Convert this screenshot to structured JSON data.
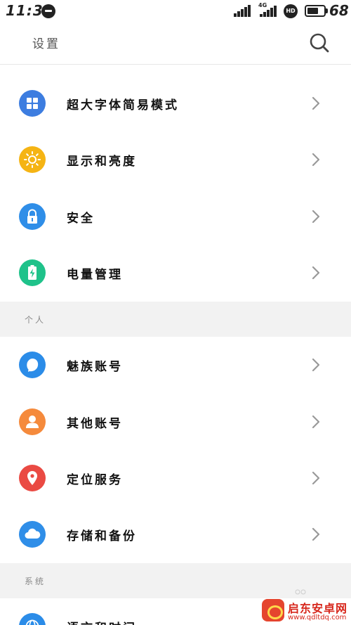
{
  "status_bar": {
    "time": "11:33",
    "network_type": "4G",
    "hd_label": "HD",
    "battery_percent": "68",
    "battery_level": 0.68
  },
  "header": {
    "title": "设置"
  },
  "items": [
    {
      "label": "超大字体简易模式",
      "icon": "grid-icon",
      "color": "#3d7de0"
    },
    {
      "label": "显示和亮度",
      "icon": "sun-icon",
      "color": "#f5b414"
    },
    {
      "label": "安全",
      "icon": "lock-icon",
      "color": "#2f8ee8"
    },
    {
      "label": "电量管理",
      "icon": "battery-icon",
      "color": "#1fc28a"
    }
  ],
  "sections": [
    {
      "title": "个人",
      "items": [
        {
          "label": "魅族账号",
          "icon": "meizu-account-icon",
          "color": "#2b8ce8"
        },
        {
          "label": "其他账号",
          "icon": "person-icon",
          "color": "#f58a3c"
        },
        {
          "label": "定位服务",
          "icon": "location-pin-icon",
          "color": "#ea4a43"
        },
        {
          "label": "存储和备份",
          "icon": "cloud-icon",
          "color": "#2f8ee8"
        }
      ]
    },
    {
      "title": "系统",
      "items": [
        {
          "label": "语言和时间",
          "icon": "globe-icon",
          "color": "#2b8ce8"
        }
      ]
    }
  ],
  "watermark": {
    "name": "启东安卓网",
    "url": "www.qdltdq.com"
  }
}
